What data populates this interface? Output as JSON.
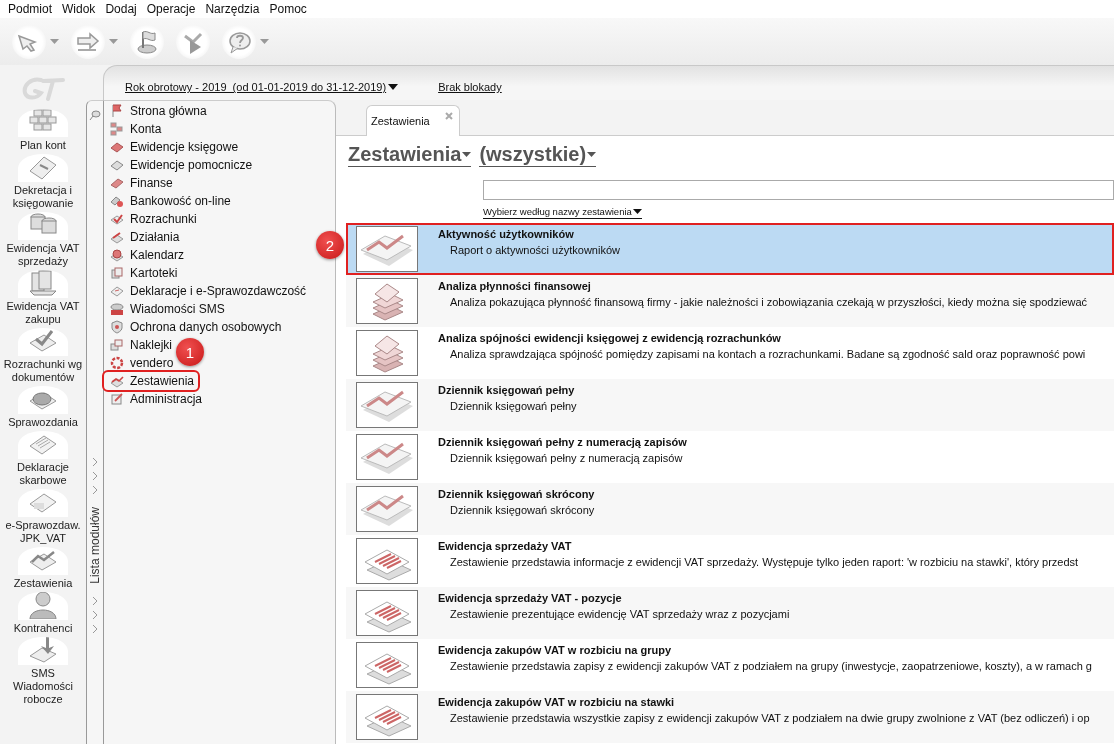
{
  "menu": [
    "Podmiot",
    "Widok",
    "Dodaj",
    "Operacje",
    "Narzędzia",
    "Pomoc"
  ],
  "toolbar": [
    {
      "dropdown": true
    },
    {
      "dropdown": true
    },
    {
      "dropdown": false
    },
    {
      "dropdown": false
    },
    {
      "dropdown": true
    }
  ],
  "quick_launch": [
    {
      "label": "Plan kont"
    },
    {
      "label": "Dekretacja i\nksięgowanie"
    },
    {
      "label": "Ewidencja VAT\nsprzedaży"
    },
    {
      "label": "Ewidencja VAT\nzakupu"
    },
    {
      "label": "Rozrachunki wg\ndokumentów"
    },
    {
      "label": "Sprawozdania"
    },
    {
      "label": "Deklaracje\nskarbowe"
    },
    {
      "label": "e-Sprawozdaw.\nJPK_VAT"
    },
    {
      "label": "Zestawienia"
    },
    {
      "label": "Kontrahenci"
    },
    {
      "label": "SMS\nWiadomości\nrobocze"
    }
  ],
  "header": {
    "fiscal_year": "Rok obrotowy - 2019  (od 01-01-2019 do 31-12-2019)",
    "lock_status": "Brak blokady"
  },
  "modules_panel": {
    "title": "Lista modułów",
    "items": [
      {
        "label": "Strona główna",
        "highlighted": false
      },
      {
        "label": "Konta",
        "highlighted": false
      },
      {
        "label": "Ewidencje księgowe",
        "highlighted": false
      },
      {
        "label": "Ewidencje pomocnicze",
        "highlighted": false
      },
      {
        "label": "Finanse",
        "highlighted": false
      },
      {
        "label": "Bankowość on-line",
        "highlighted": false
      },
      {
        "label": "Rozrachunki",
        "highlighted": false
      },
      {
        "label": "Działania",
        "highlighted": false
      },
      {
        "label": "Kalendarz",
        "highlighted": false
      },
      {
        "label": "Kartoteki",
        "highlighted": false
      },
      {
        "label": "Deklaracje i e-Sprawozdawczość",
        "highlighted": false
      },
      {
        "label": "Wiadomości SMS",
        "highlighted": false
      },
      {
        "label": "Ochrona danych osobowych",
        "highlighted": false
      },
      {
        "label": "Naklejki",
        "highlighted": false
      },
      {
        "label": "vendero",
        "highlighted": false
      },
      {
        "label": "Zestawienia",
        "highlighted": true,
        "badge": "1"
      },
      {
        "label": "Administracja",
        "highlighted": false
      }
    ]
  },
  "tabs": [
    {
      "label": "Zestawienia",
      "selected": true
    }
  ],
  "heading": {
    "category": "Zestawienia",
    "filter": "(wszystkie)"
  },
  "sort_link": "Wybierz według nazwy zestawienia",
  "reports": [
    {
      "title": "Aktywność użytkowników",
      "description": "Raport o aktywności użytkowników",
      "selected": true,
      "highlighted": true,
      "badge": "2"
    },
    {
      "title": "Analiza płynności finansowej",
      "description": "Analiza pokazująca płynność finansową firmy - jakie należności i zobowiązania czekają w przyszłości, kiedy można się spodziewać",
      "selected": false,
      "highlighted": false
    },
    {
      "title": "Analiza spójności ewidencji księgowej z ewidencją rozrachunków",
      "description": "Analiza sprawdzająca spójność pomiędzy zapisami na kontach a rozrachunkami. Badane są zgodność sald oraz poprawność powi",
      "selected": false,
      "highlighted": false
    },
    {
      "title": "Dziennik księgowań pełny",
      "description": "Dziennik księgowań pełny",
      "selected": false,
      "highlighted": false
    },
    {
      "title": "Dziennik księgowań pełny z numeracją zapisów",
      "description": "Dziennik księgowań pełny z numeracją zapisów",
      "selected": false,
      "highlighted": false
    },
    {
      "title": "Dziennik księgowań skrócony",
      "description": "Dziennik księgowań skrócony",
      "selected": false,
      "highlighted": false
    },
    {
      "title": "Ewidencja sprzedaży VAT",
      "description": "Zestawienie przedstawia informacje z ewidencji VAT sprzedaży. Występuje tylko jeden raport: 'w rozbiciu na stawki', który przedst",
      "selected": false,
      "highlighted": false
    },
    {
      "title": "Ewidencja sprzedaży VAT - pozycje",
      "description": "Zestawienie prezentujące ewidencję VAT sprzedaży wraz z pozycjami",
      "selected": false,
      "highlighted": false
    },
    {
      "title": "Ewidencja zakupów VAT w rozbiciu na grupy",
      "description": "Zestawienie przedstawia zapisy z ewidencji zakupów VAT z podziałem na grupy (inwestycje, zaopatrzeniowe, koszty), a w ramach g",
      "selected": false,
      "highlighted": false
    },
    {
      "title": "Ewidencja zakupów VAT w rozbiciu na stawki",
      "description": "Zestawienie przedstawia wszystkie zapisy z ewidencji zakupów VAT z podziałem na dwie grupy zwolnione z VAT (bez odliczeń) i op",
      "selected": false,
      "highlighted": false
    }
  ]
}
